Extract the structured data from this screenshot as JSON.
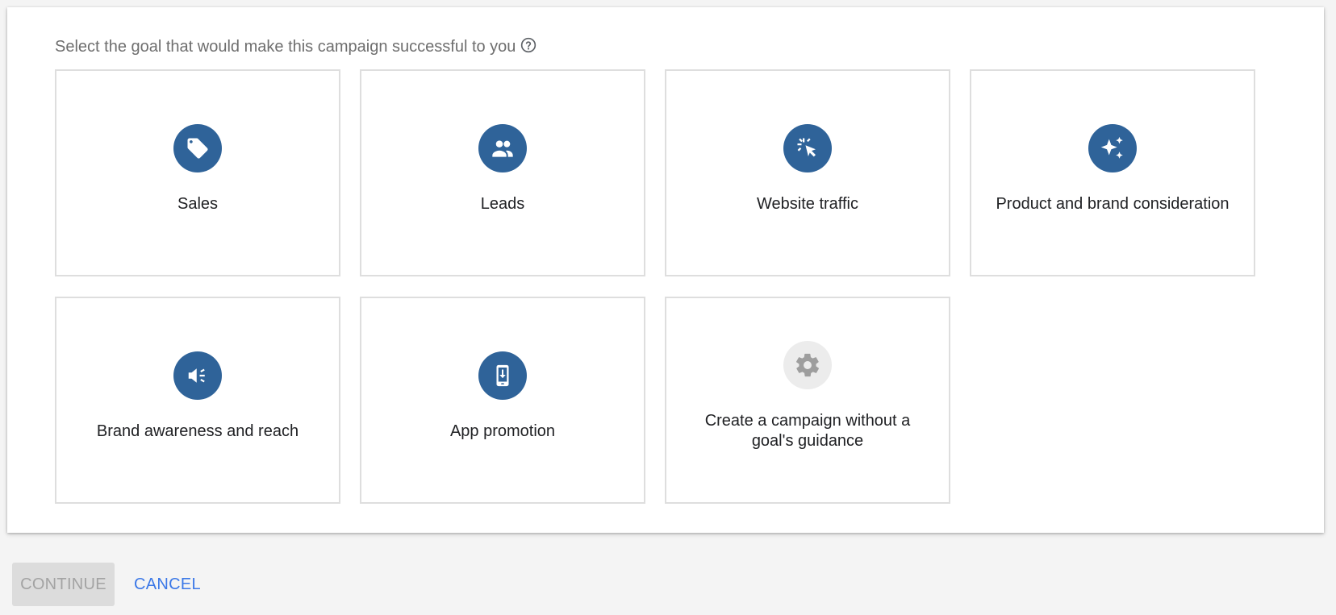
{
  "prompt": {
    "text": "Select the goal that would make this campaign successful to you",
    "help_icon": "help-circle-icon"
  },
  "goals": [
    {
      "label": "Sales",
      "icon": "tag-icon"
    },
    {
      "label": "Leads",
      "icon": "people-icon"
    },
    {
      "label": "Website traffic",
      "icon": "cursor-click-icon"
    },
    {
      "label": "Product and brand consideration",
      "icon": "sparkle-icon"
    },
    {
      "label": "Brand awareness and reach",
      "icon": "megaphone-icon"
    },
    {
      "label": "App promotion",
      "icon": "phone-download-icon"
    },
    {
      "label": "Create a campaign without a goal's guidance",
      "icon": "gear-icon"
    }
  ],
  "footer": {
    "continue_label": "CONTINUE",
    "cancel_label": "CANCEL"
  },
  "colors": {
    "accent": "#2f6399",
    "link": "#3b78e7",
    "disabled_bg": "#dcdcdc",
    "disabled_text": "#a3a3a3"
  }
}
